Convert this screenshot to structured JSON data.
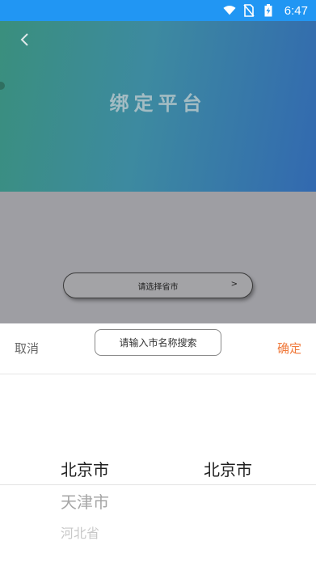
{
  "status_bar": {
    "time": "6:47",
    "icons": [
      "wifi-icon",
      "no-sim-icon",
      "battery-charging-icon"
    ]
  },
  "hero": {
    "title": "绑定平台",
    "back_icon": "back-chevron-icon"
  },
  "form": {
    "province_select_label": "请选择省市",
    "province_select_arrow": ">"
  },
  "picker": {
    "cancel_label": "取消",
    "confirm_label": "确定",
    "search_placeholder": "请输入市名称搜索",
    "provinces": [
      "北京市",
      "天津市",
      "河北省"
    ],
    "cities": [
      "北京市"
    ]
  },
  "colors": {
    "status_bar": "#2196f3",
    "confirm": "#f07a3c",
    "overlay": "#9e9ea3"
  }
}
